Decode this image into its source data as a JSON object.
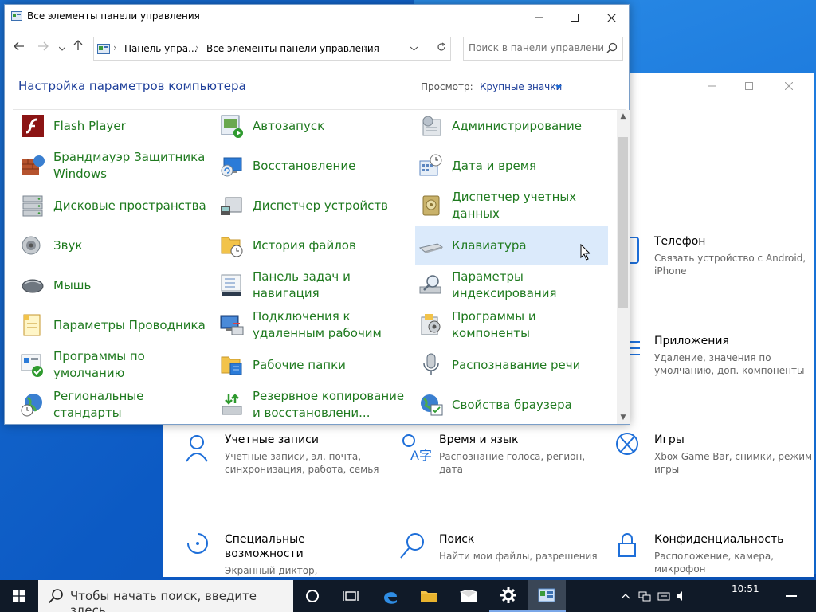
{
  "control_panel": {
    "title": "Все элементы панели управления",
    "breadcrumb": [
      "Панель упра...",
      "Все элементы панели управления"
    ],
    "search_placeholder": "Поиск в панели управления",
    "heading": "Настройка параметров компьютера",
    "view_label": "Просмотр:",
    "view_value": "Крупные значки",
    "items": [
      {
        "label": "Flash Player",
        "icon": "flash-player-icon"
      },
      {
        "label": "Автозапуск",
        "icon": "autoplay-icon"
      },
      {
        "label": "Администрирование",
        "icon": "admin-tools-icon"
      },
      {
        "label": "Брандмауэр Защитника Windows",
        "icon": "firewall-icon"
      },
      {
        "label": "Восстановление",
        "icon": "recovery-icon"
      },
      {
        "label": "Дата и время",
        "icon": "date-time-icon"
      },
      {
        "label": "Дисковые пространства",
        "icon": "storage-spaces-icon"
      },
      {
        "label": "Диспетчер устройств",
        "icon": "device-manager-icon"
      },
      {
        "label": "Диспетчер учетных данных",
        "icon": "credential-manager-icon"
      },
      {
        "label": "Звук",
        "icon": "sound-icon"
      },
      {
        "label": "История файлов",
        "icon": "file-history-icon"
      },
      {
        "label": "Клавиатура",
        "icon": "keyboard-icon"
      },
      {
        "label": "Мышь",
        "icon": "mouse-icon"
      },
      {
        "label": "Панель задач и навигация",
        "icon": "taskbar-navigation-icon"
      },
      {
        "label": "Параметры индексирования",
        "icon": "indexing-options-icon"
      },
      {
        "label": "Параметры Проводника",
        "icon": "explorer-options-icon"
      },
      {
        "label": "Подключения к удаленным рабочим",
        "icon": "remote-connections-icon"
      },
      {
        "label": "Программы и компоненты",
        "icon": "programs-features-icon"
      },
      {
        "label": "Программы по умолчанию",
        "icon": "default-programs-icon"
      },
      {
        "label": "Рабочие папки",
        "icon": "work-folders-icon"
      },
      {
        "label": "Распознавание речи",
        "icon": "speech-recognition-icon"
      },
      {
        "label": "Региональные стандарты",
        "icon": "region-icon"
      },
      {
        "label": "Резервное копирование и восстановлени...",
        "icon": "backup-restore-icon"
      },
      {
        "label": "Свойства браузера",
        "icon": "internet-options-icon"
      }
    ]
  },
  "settings": {
    "tiles": [
      {
        "title": "Телефон",
        "desc": "Связать устройство с Android, iPhone",
        "icon": "phone-icon"
      },
      {
        "title": "Приложения",
        "desc": "Удаление, значения по умолчанию, доп. компоненты",
        "icon": "apps-icon"
      },
      {
        "title": "Учетные записи",
        "desc": "Учетные записи, эл. почта, синхронизация, работа, семья",
        "icon": "accounts-icon"
      },
      {
        "title": "Время и язык",
        "desc": "Распознание голоса, регион, дата",
        "icon": "time-language-icon"
      },
      {
        "title": "Игры",
        "desc": "Xbox Game Bar, снимки, режим игры",
        "icon": "gaming-icon"
      },
      {
        "title": "Специальные возможности",
        "desc": "Экранный диктор,",
        "icon": "accessibility-icon"
      },
      {
        "title": "Поиск",
        "desc": "Найти мои файлы, разрешения",
        "icon": "search-icon"
      },
      {
        "title": "Конфиденциальность",
        "desc": "Расположение, камера, микрофон",
        "icon": "privacy-lock-icon"
      }
    ]
  },
  "taskbar": {
    "search_text": "Чтобы начать поиск, введите здесь",
    "time": "10:51"
  },
  "colors": {
    "link_green": "#1f7a1f",
    "heading_blue": "#1e3f9a",
    "hover": "#dbeafb",
    "taskbar": "#101a28"
  }
}
